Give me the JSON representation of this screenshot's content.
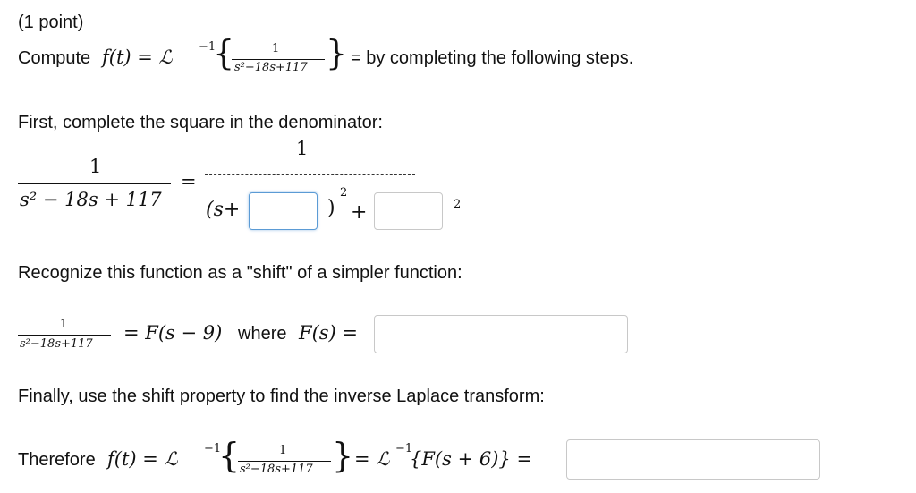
{
  "header": {
    "points": "(1 point)"
  },
  "line1": {
    "prefix": "Compute",
    "f_of_t": "f(t) = ℒ",
    "inv": "−1",
    "numerator": "1",
    "denominator": "s²−18s+117",
    "suffix": "= by completing the following steps."
  },
  "step1": {
    "heading": "First, complete the square in the denominator:",
    "lhs_numerator": "1",
    "lhs_denominator": "s² − 18s + 117",
    "equals": "=",
    "rhs_numerator": "1",
    "paren_open": "(s+",
    "paren_close": ")",
    "square": "2",
    "plus": "+",
    "trailing_exp": "2",
    "input_shift_value": "",
    "input_const_value": ""
  },
  "step2": {
    "heading": "Recognize this function as a \"shift\" of a simpler function:",
    "numerator": "1",
    "denominator": "s²−18s+117",
    "expr": "= F(s − 9)",
    "where": "where",
    "fs": "F(s) =",
    "input_value": ""
  },
  "step3": {
    "heading": "Finally, use the shift property to find the inverse Laplace transform:",
    "prefix": "Therefore",
    "f_of_t": "f(t) = ℒ",
    "inv": "−1",
    "numerator": "1",
    "denominator": "s²−18s+117",
    "middle": "= ℒ",
    "inv2": "−1",
    "tail": "{F(s + 6)} =",
    "input_value": ""
  }
}
